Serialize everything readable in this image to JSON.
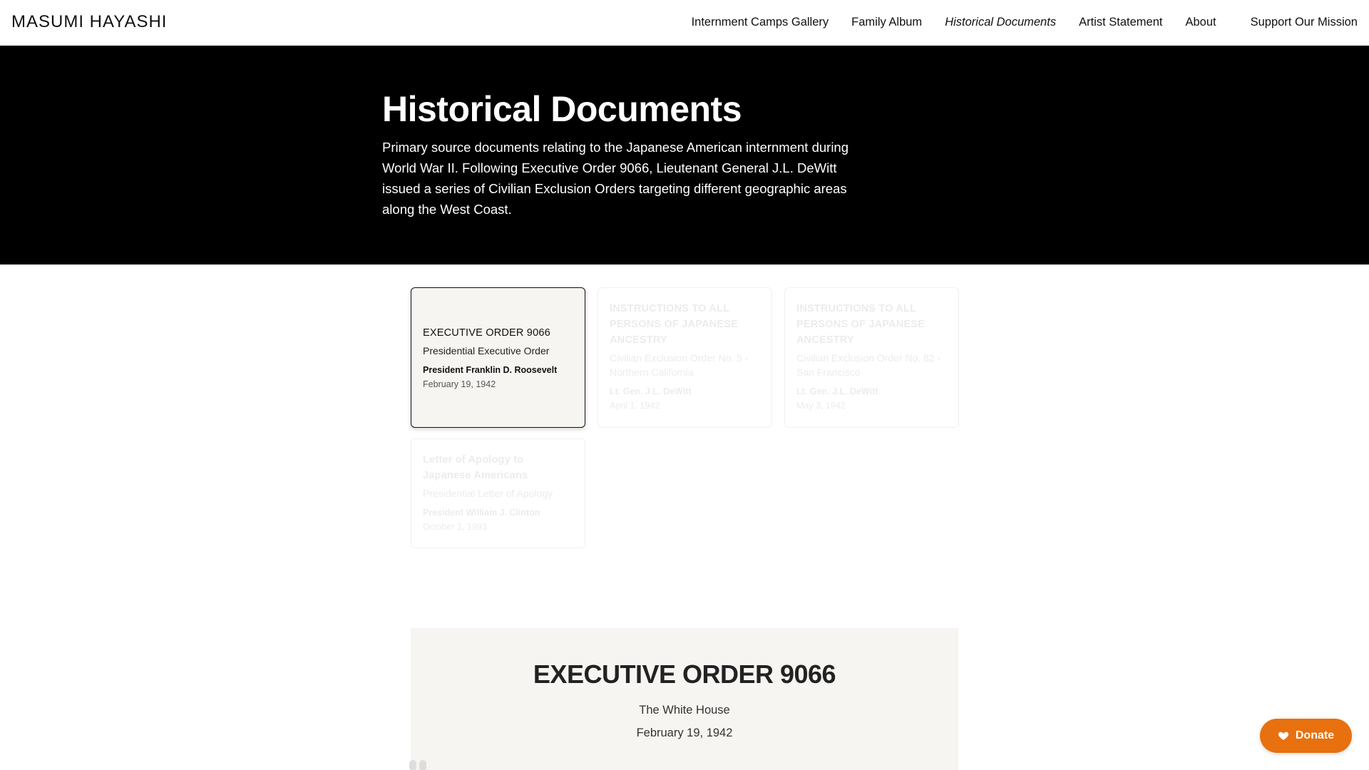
{
  "brand": "MASUMI HAYASHI",
  "nav": [
    {
      "label": "Internment Camps Gallery",
      "active": false
    },
    {
      "label": "Family Album",
      "active": false
    },
    {
      "label": "Historical Documents",
      "active": true
    },
    {
      "label": "Artist Statement",
      "active": false
    },
    {
      "label": "About",
      "active": false
    }
  ],
  "nav_support": "Support Our Mission",
  "hero": {
    "title": "Historical Documents",
    "description": "Primary source documents relating to the Japanese American internment during World War II. Following Executive Order 9066, Lieutenant General J.L. DeWitt issued a series of Civilian Exclusion Orders targeting different geographic areas along the West Coast."
  },
  "documents": [
    {
      "title": "EXECUTIVE ORDER 9066",
      "type": "Presidential Executive Order",
      "author": "President Franklin D. Roosevelt",
      "date": "February 19, 1942",
      "selected": true
    },
    {
      "title": "INSTRUCTIONS TO ALL PERSONS OF JAPANESE ANCESTRY",
      "type": "Civilian Exclusion Order No. 5 - Northern California",
      "author": "Lt. Gen. J.L. DeWitt",
      "date": "April 1, 1942",
      "selected": false
    },
    {
      "title": "INSTRUCTIONS TO ALL PERSONS OF JAPANESE ANCESTRY",
      "type": "Civilian Exclusion Order No. 82 - San Francisco",
      "author": "Lt. Gen. J.L. DeWitt",
      "date": "May 3, 1942",
      "selected": false
    },
    {
      "title": "Letter of Apology to Japanese Americans",
      "type": "Presidential Letter of Apology",
      "author": "President William J. Clinton",
      "date": "October 1, 1993",
      "selected": false
    }
  ],
  "viewer": {
    "title": "EXECUTIVE ORDER 9066",
    "subtitle": "The White House",
    "date": "February 19, 1942"
  },
  "donate": {
    "label": "Donate",
    "icon": "heart-icon",
    "color": "#e8700f"
  }
}
